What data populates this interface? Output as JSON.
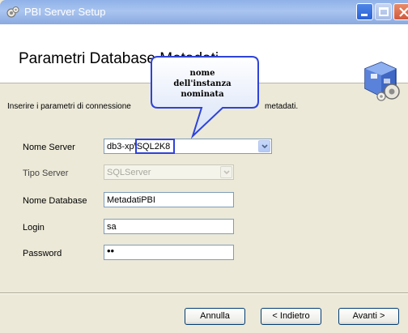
{
  "window": {
    "title": "PBI Server Setup"
  },
  "header": {
    "title": "Parametri Database Metadati"
  },
  "instructions": {
    "text_start": "Inserire i parametri di connessione",
    "text_end": "metadati."
  },
  "callout": {
    "line1": "nome",
    "line2": "dell'instanza",
    "line3": "nominata"
  },
  "form": {
    "server_label": "Nome Server",
    "server_value_prefix": "db3-xp\\",
    "server_value_instance": "SQL2K8",
    "type_label": "Tipo Server",
    "type_value": "SQLServer",
    "database_label": "Nome Database",
    "database_value": "MetadatiPBI",
    "login_label": "Login",
    "login_value": "sa",
    "password_label": "Password",
    "password_value": "••"
  },
  "buttons": {
    "cancel": "Annulla",
    "back": "< Indietro",
    "next": "Avanti >"
  }
}
